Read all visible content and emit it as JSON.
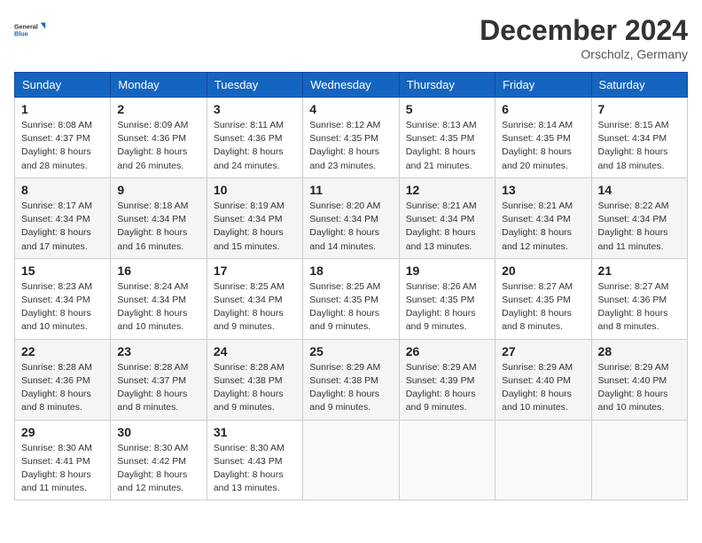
{
  "header": {
    "logo_line1": "General",
    "logo_line2": "Blue",
    "month_title": "December 2024",
    "location": "Orscholz, Germany"
  },
  "days_of_week": [
    "Sunday",
    "Monday",
    "Tuesday",
    "Wednesday",
    "Thursday",
    "Friday",
    "Saturday"
  ],
  "weeks": [
    [
      {
        "day": "1",
        "sunrise": "8:08 AM",
        "sunset": "4:37 PM",
        "daylight": "8 hours and 28 minutes."
      },
      {
        "day": "2",
        "sunrise": "8:09 AM",
        "sunset": "4:36 PM",
        "daylight": "8 hours and 26 minutes."
      },
      {
        "day": "3",
        "sunrise": "8:11 AM",
        "sunset": "4:36 PM",
        "daylight": "8 hours and 24 minutes."
      },
      {
        "day": "4",
        "sunrise": "8:12 AM",
        "sunset": "4:35 PM",
        "daylight": "8 hours and 23 minutes."
      },
      {
        "day": "5",
        "sunrise": "8:13 AM",
        "sunset": "4:35 PM",
        "daylight": "8 hours and 21 minutes."
      },
      {
        "day": "6",
        "sunrise": "8:14 AM",
        "sunset": "4:35 PM",
        "daylight": "8 hours and 20 minutes."
      },
      {
        "day": "7",
        "sunrise": "8:15 AM",
        "sunset": "4:34 PM",
        "daylight": "8 hours and 18 minutes."
      }
    ],
    [
      {
        "day": "8",
        "sunrise": "8:17 AM",
        "sunset": "4:34 PM",
        "daylight": "8 hours and 17 minutes."
      },
      {
        "day": "9",
        "sunrise": "8:18 AM",
        "sunset": "4:34 PM",
        "daylight": "8 hours and 16 minutes."
      },
      {
        "day": "10",
        "sunrise": "8:19 AM",
        "sunset": "4:34 PM",
        "daylight": "8 hours and 15 minutes."
      },
      {
        "day": "11",
        "sunrise": "8:20 AM",
        "sunset": "4:34 PM",
        "daylight": "8 hours and 14 minutes."
      },
      {
        "day": "12",
        "sunrise": "8:21 AM",
        "sunset": "4:34 PM",
        "daylight": "8 hours and 13 minutes."
      },
      {
        "day": "13",
        "sunrise": "8:21 AM",
        "sunset": "4:34 PM",
        "daylight": "8 hours and 12 minutes."
      },
      {
        "day": "14",
        "sunrise": "8:22 AM",
        "sunset": "4:34 PM",
        "daylight": "8 hours and 11 minutes."
      }
    ],
    [
      {
        "day": "15",
        "sunrise": "8:23 AM",
        "sunset": "4:34 PM",
        "daylight": "8 hours and 10 minutes."
      },
      {
        "day": "16",
        "sunrise": "8:24 AM",
        "sunset": "4:34 PM",
        "daylight": "8 hours and 10 minutes."
      },
      {
        "day": "17",
        "sunrise": "8:25 AM",
        "sunset": "4:34 PM",
        "daylight": "8 hours and 9 minutes."
      },
      {
        "day": "18",
        "sunrise": "8:25 AM",
        "sunset": "4:35 PM",
        "daylight": "8 hours and 9 minutes."
      },
      {
        "day": "19",
        "sunrise": "8:26 AM",
        "sunset": "4:35 PM",
        "daylight": "8 hours and 9 minutes."
      },
      {
        "day": "20",
        "sunrise": "8:27 AM",
        "sunset": "4:35 PM",
        "daylight": "8 hours and 8 minutes."
      },
      {
        "day": "21",
        "sunrise": "8:27 AM",
        "sunset": "4:36 PM",
        "daylight": "8 hours and 8 minutes."
      }
    ],
    [
      {
        "day": "22",
        "sunrise": "8:28 AM",
        "sunset": "4:36 PM",
        "daylight": "8 hours and 8 minutes."
      },
      {
        "day": "23",
        "sunrise": "8:28 AM",
        "sunset": "4:37 PM",
        "daylight": "8 hours and 8 minutes."
      },
      {
        "day": "24",
        "sunrise": "8:28 AM",
        "sunset": "4:38 PM",
        "daylight": "8 hours and 9 minutes."
      },
      {
        "day": "25",
        "sunrise": "8:29 AM",
        "sunset": "4:38 PM",
        "daylight": "8 hours and 9 minutes."
      },
      {
        "day": "26",
        "sunrise": "8:29 AM",
        "sunset": "4:39 PM",
        "daylight": "8 hours and 9 minutes."
      },
      {
        "day": "27",
        "sunrise": "8:29 AM",
        "sunset": "4:40 PM",
        "daylight": "8 hours and 10 minutes."
      },
      {
        "day": "28",
        "sunrise": "8:29 AM",
        "sunset": "4:40 PM",
        "daylight": "8 hours and 10 minutes."
      }
    ],
    [
      {
        "day": "29",
        "sunrise": "8:30 AM",
        "sunset": "4:41 PM",
        "daylight": "8 hours and 11 minutes."
      },
      {
        "day": "30",
        "sunrise": "8:30 AM",
        "sunset": "4:42 PM",
        "daylight": "8 hours and 12 minutes."
      },
      {
        "day": "31",
        "sunrise": "8:30 AM",
        "sunset": "4:43 PM",
        "daylight": "8 hours and 13 minutes."
      },
      null,
      null,
      null,
      null
    ]
  ]
}
